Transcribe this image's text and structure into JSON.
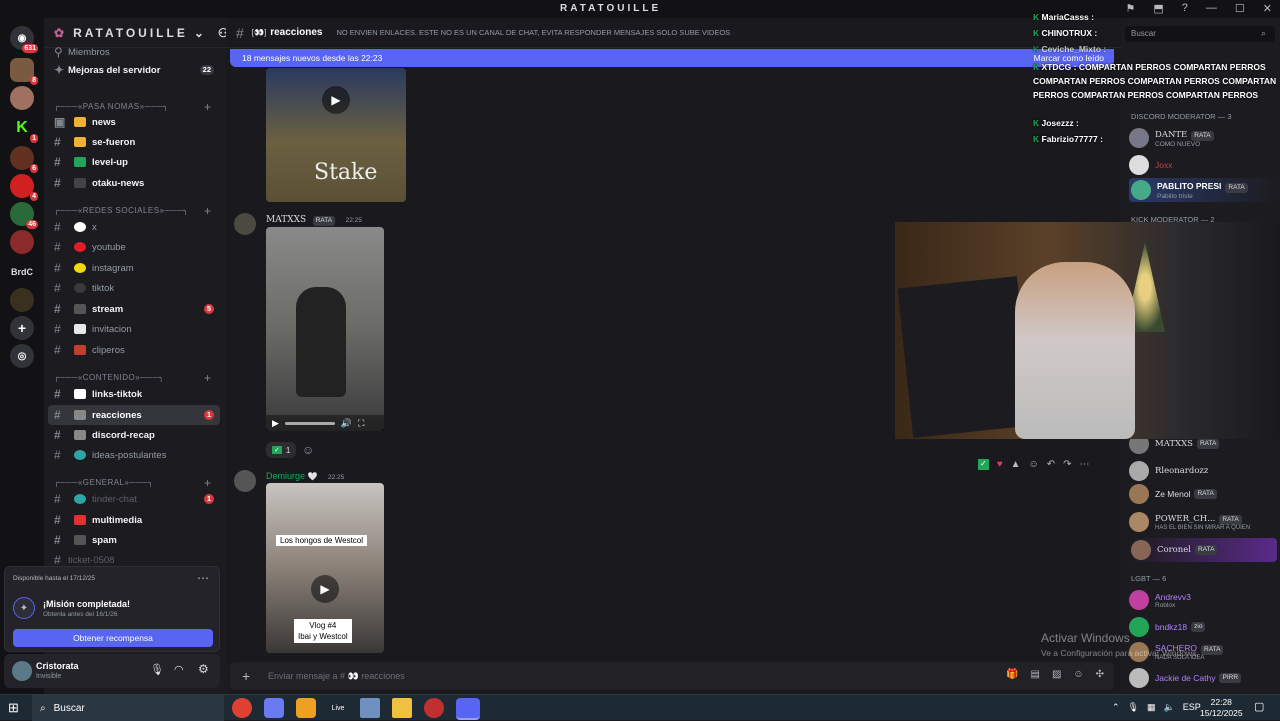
{
  "window": {
    "title": "RATATOUILLE",
    "search_placeholder": "Buscar"
  },
  "servers": {
    "badge_top": "631",
    "badges": [
      "8",
      "1",
      "6",
      "4",
      "46"
    ],
    "folder_label": "BrdC"
  },
  "server": {
    "name": "RATATOUILLE",
    "members_label": "Miembros",
    "boost_label": "Mejoras del servidor",
    "boost_count": "22"
  },
  "categories": [
    {
      "label": "╭───«PASA NOMAS»───╮"
    },
    {
      "label": "╭───«REDES SOCIALES»───╮"
    },
    {
      "label": "╭───«CONTENIDO»───╮"
    },
    {
      "label": "╭───«GENERAL»───╮"
    }
  ],
  "channels": [
    {
      "name": "news",
      "bold": true,
      "count": "",
      "icon_color": "#f0b232"
    },
    {
      "name": "se-fueron",
      "bold": true,
      "count": "",
      "icon_color": "#f0b232"
    },
    {
      "name": "level-up",
      "bold": true,
      "count": "",
      "icon_color": "#23a559"
    },
    {
      "name": "otaku-news",
      "bold": true,
      "count": "",
      "icon_color": "#b5bac1"
    },
    {
      "name": "x",
      "bold": false,
      "count": "",
      "icon_color": "#ffffff"
    },
    {
      "name": "youtube",
      "bold": false,
      "count": "",
      "icon_color": "#e11d2a"
    },
    {
      "name": "instagram",
      "bold": false,
      "count": "",
      "icon_color": "#f5d90a"
    },
    {
      "name": "tiktok",
      "bold": false,
      "count": "",
      "icon_color": "#3a3a3a"
    },
    {
      "name": "stream",
      "bold": true,
      "count": "5",
      "icon_color": "#b5bac1"
    },
    {
      "name": "invitacion",
      "bold": false,
      "count": "",
      "icon_color": "#e8e8e8"
    },
    {
      "name": "cliperos",
      "bold": false,
      "count": "",
      "icon_color": "#c04030"
    },
    {
      "name": "links-tiktok",
      "bold": true,
      "count": "",
      "icon_color": "#ffffff"
    },
    {
      "name": "reacciones",
      "bold": true,
      "count": "1",
      "icon_color": "#b5bac1"
    },
    {
      "name": "discord-recap",
      "bold": true,
      "count": "",
      "icon_color": "#b5bac1"
    },
    {
      "name": "ideas-postulantes",
      "bold": false,
      "count": "",
      "icon_color": "#2aa6a6"
    },
    {
      "name": "tinder-chat",
      "bold": false,
      "count": "1",
      "icon_color": "#2aa6a6"
    },
    {
      "name": "multimedia",
      "bold": true,
      "count": "",
      "icon_color": "#e03030"
    },
    {
      "name": "spam",
      "bold": true,
      "count": "",
      "icon_color": "#b5bac1"
    },
    {
      "name": "ticket-0508",
      "bold": false,
      "count": "",
      "icon_color": ""
    }
  ],
  "quest": {
    "available": "Disponible hasta el 17/12/25",
    "title": "¡Misión completada!",
    "subtitle": "Obtenla antes del 16/1/26",
    "button": "Obtener recompensa"
  },
  "user": {
    "name": "Cristorata",
    "status": "Invisible"
  },
  "chat": {
    "channel_name": "reacciones",
    "topic": "NO ENVIEN ENLACES. ESTE NO ES UN CANAL DE CHAT, EVITA RESPONDER MENSAJES SOLO SUBE VIDEOS",
    "new_messages": "18 mensajes nuevos desde las 22:23",
    "mark_read": "Marcar como leído",
    "msg1_author": "MATXXS",
    "msg1_role": "RATA",
    "msg1_time": "22:25",
    "reaction_count": "1",
    "msg2_author": "Demiurge",
    "msg2_time": "22:25",
    "thumb1_brand": "Stake",
    "thumb2_caption1": "Los hongos de Westcol",
    "thumb2_caption2": "Vlog #4\nIbai y Westcol",
    "composer_placeholder": "Enviar mensaje a # 👀 reacciones"
  },
  "overlay_chat": [
    {
      "user": "MariaCasss :",
      "text": ""
    },
    {
      "user": "CHINOTRUX :",
      "text": ""
    },
    {
      "user": "Ceviche_Mixto :",
      "text": ""
    },
    {
      "user": "XTDCG :",
      "text": "COMPARTAN PERROS COMPARTAN PERROS COMPARTAN PERROS COMPARTAN PERROS COMPARTAN PERROS COMPARTAN PERROS COMPARTAN PERROS"
    },
    {
      "user": "Josezzz :",
      "text": ""
    },
    {
      "user": "Fabrizio77777 :",
      "text": ""
    }
  ],
  "members": {
    "discord_mod_header": "DISCORD MODERATOR — 3",
    "kick_mod_header": "KICK MODERATOR — 2",
    "lgbt_header": "LGBT — 6",
    "mods": [
      {
        "name": "DANTE",
        "role": "RATA",
        "status": "COMO NUEVO"
      },
      {
        "name": "Joxx",
        "role": "",
        "status": ""
      },
      {
        "name": "PABLITO PRESI",
        "role": "RATA",
        "status": "Pablito triste"
      }
    ],
    "list": [
      {
        "name": "MATXXS",
        "role": "RATA",
        "status": ""
      },
      {
        "name": "Rleonardozz",
        "role": "",
        "status": ""
      },
      {
        "name": "Ze Menol",
        "role": "RATA",
        "status": ""
      },
      {
        "name": "POWER_CH...",
        "role": "RATA",
        "status": "HAS EL BIEN SIN MIRAR A QUIEN"
      },
      {
        "name": "Coronel",
        "role": "RATA",
        "status": ""
      }
    ],
    "lgbt": [
      {
        "name": "Andrevv3",
        "role": "",
        "status": "Roblox"
      },
      {
        "name": "bndkz18",
        "role": "zio",
        "status": ""
      },
      {
        "name": "SACHERO",
        "role": "RATA",
        "status": "NADA SOLA IDEA"
      },
      {
        "name": "Jackie de Cathy",
        "role": "PIRR",
        "status": ""
      }
    ]
  },
  "activate": {
    "line1": "Activar Windows",
    "line2": "Ve a Configuración para activar Windows."
  },
  "taskbar": {
    "search": "Buscar",
    "lang": "ESP",
    "time": "22:28",
    "date": "15/12/2025",
    "live_label": "Live"
  }
}
